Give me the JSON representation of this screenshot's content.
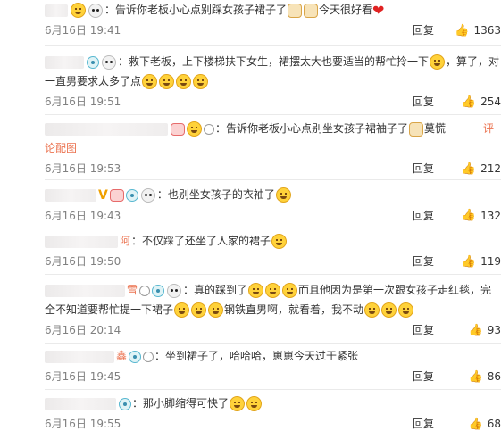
{
  "comments": [
    {
      "user_tail": "",
      "text": "：告诉你老板小心点别踩女孩子裙子了",
      "text2": "今天很好看",
      "date": "6月16日 19:41",
      "reply": "回复",
      "likes": "1363"
    },
    {
      "user_tail": "",
      "text": "：救下老板，上下楼梯扶下女生，裙摆太大也要适当的帮忙拎一下",
      "text2": "，算了，对一直男要求太多了点",
      "date": "6月16日 19:51",
      "reply": "回复",
      "likes": "254"
    },
    {
      "user_tail": "",
      "text": "：告诉你老板小心点别坐女孩子裙袖子了",
      "text2": "莫慌",
      "report": "评",
      "text3": "论配图",
      "date": "6月16日 19:53",
      "reply": "回复",
      "likes": "212"
    },
    {
      "user_tail": "",
      "text": "：也别坐女孩子的衣袖了",
      "date": "6月16日 19:43",
      "reply": "回复",
      "likes": "132"
    },
    {
      "user_tail": "阿",
      "text": "：不仅踩了还坐了人家的裙子",
      "date": "6月16日 19:50",
      "reply": "回复",
      "likes": "119"
    },
    {
      "user_tail": "雪",
      "text": "：真的踩到了",
      "text2": "而且他因为是第一次跟女孩子走红毯，完全不知道要帮忙提一下裙子",
      "text3": "钢铁直男啊，就看着，我不动",
      "date": "6月16日 20:14",
      "reply": "回复",
      "likes": "93"
    },
    {
      "user_tail": "鑫",
      "text": "：坐到裙子了，哈哈哈，崽崽今天过于紧张",
      "date": "6月16日 19:45",
      "reply": "回复",
      "likes": "86"
    },
    {
      "user_tail": "",
      "text": "：那小脚缩得可快了",
      "date": "6月16日 19:55",
      "reply": "回复",
      "likes": "68"
    }
  ],
  "icons": {
    "like": "thumbs-up-icon",
    "badge": "verified-badge-icon",
    "panda": "panda-icon",
    "emoji": "laughing-emoji-icon"
  },
  "colors": {
    "accent": "#eb7350",
    "muted": "#808080",
    "text": "#333333"
  }
}
